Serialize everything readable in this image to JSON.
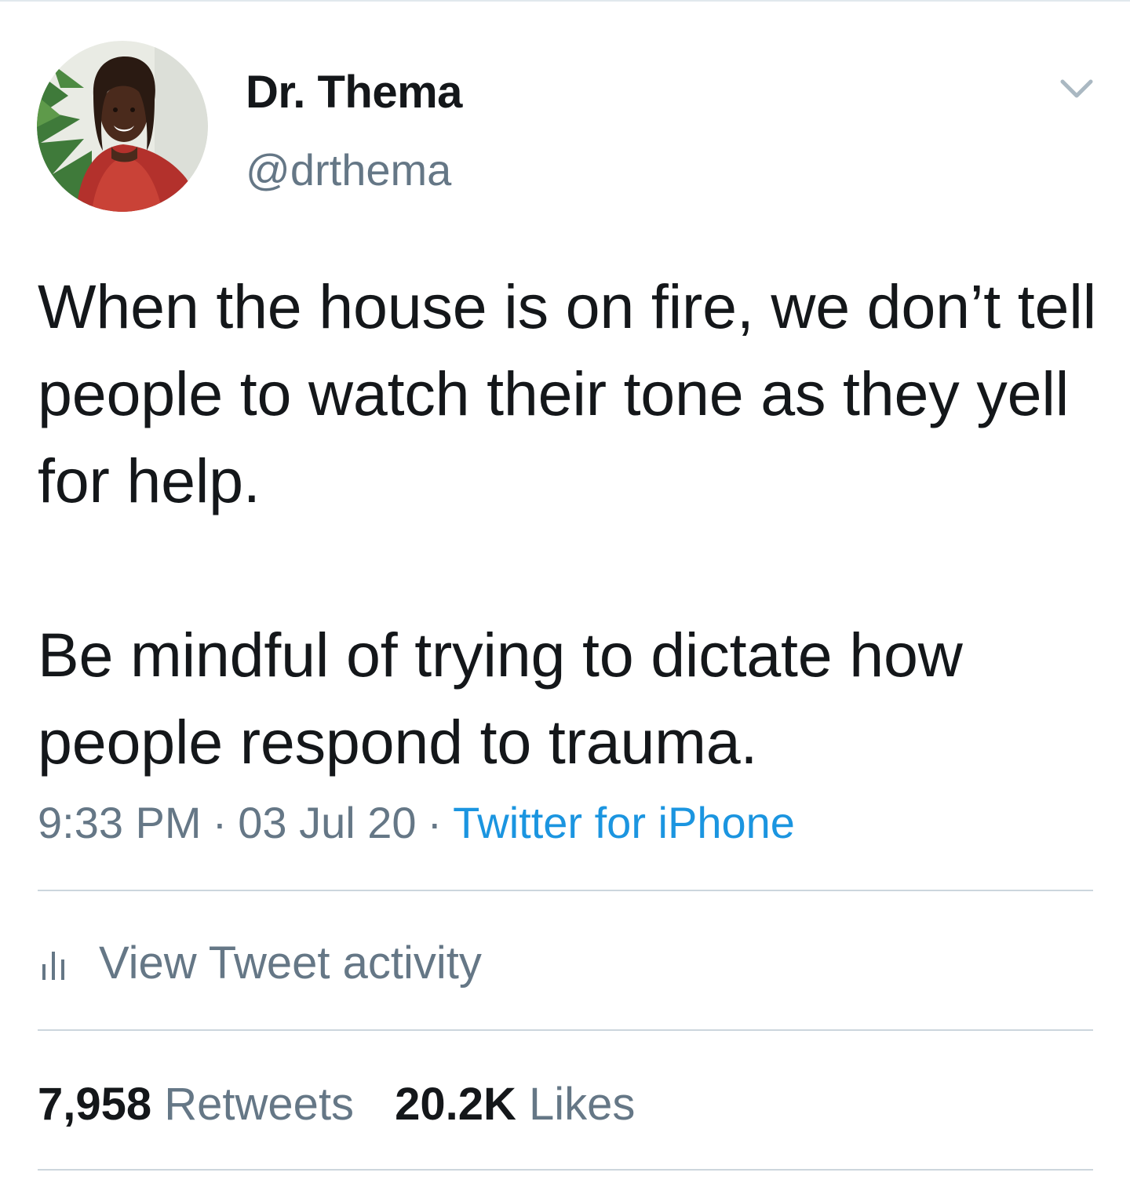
{
  "author": {
    "display_name": "Dr. Thema",
    "handle": "@drthema",
    "avatar_icon": "profile-photo"
  },
  "tweet": {
    "paragraphs": [
      "When the house is on fire, we don’t tell people to watch their tone as they yell for help.",
      "Be mindful of trying to dictate how people respond to trauma."
    ],
    "time": "9:33 PM",
    "separator": "·",
    "date": "03 Jul 20",
    "source": "Twitter for iPhone"
  },
  "activity": {
    "icon": "bar-chart-icon",
    "label": "View Tweet activity"
  },
  "stats": {
    "retweets_count": "7,958",
    "retweets_label": "Retweets",
    "likes_count": "20.2K",
    "likes_label": "Likes"
  },
  "menu_icon": "chevron-down-icon",
  "colors": {
    "text_primary": "#14171a",
    "text_secondary": "#657786",
    "link": "#1b95e0",
    "divider": "#ccd6dd"
  }
}
